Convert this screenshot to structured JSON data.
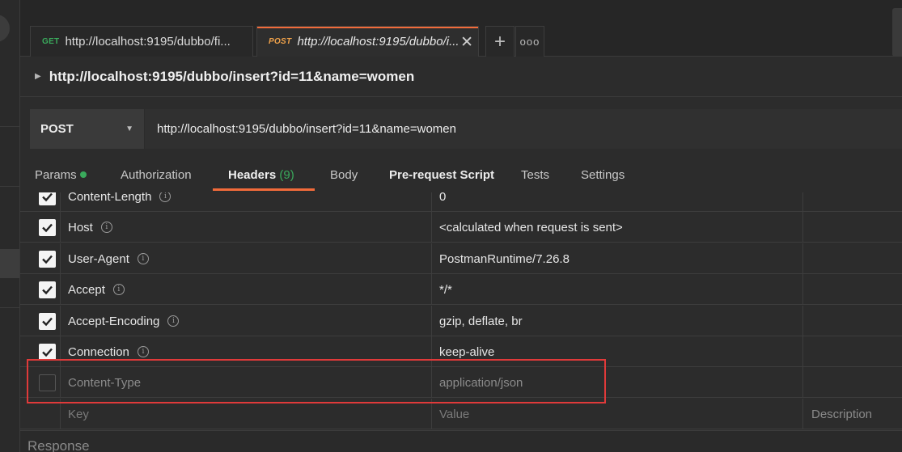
{
  "tabs": [
    {
      "method": "GET",
      "url": "http://localhost:9195/dubbo/fi..."
    },
    {
      "method": "POST",
      "url": "http://localhost:9195/dubbo/i..."
    }
  ],
  "tab_actions": {
    "add": "+",
    "more": "ooo",
    "close": "✕"
  },
  "request": {
    "title": "http://localhost:9195/dubbo/insert?id=11&name=women",
    "method": "POST",
    "url": "http://localhost:9195/dubbo/insert?id=11&name=women"
  },
  "request_tabs": {
    "params": "Params",
    "authorization": "Authorization",
    "headers": "Headers",
    "headers_count": "(9)",
    "body": "Body",
    "prerequest": "Pre-request Script",
    "tests": "Tests",
    "settings": "Settings"
  },
  "headers": [
    {
      "key": "Content-Length",
      "value": "0",
      "checked": true
    },
    {
      "key": "Host",
      "value": "<calculated when request is sent>",
      "checked": true
    },
    {
      "key": "User-Agent",
      "value": "PostmanRuntime/7.26.8",
      "checked": true
    },
    {
      "key": "Accept",
      "value": "*/*",
      "checked": true
    },
    {
      "key": "Accept-Encoding",
      "value": "gzip, deflate, br",
      "checked": true
    },
    {
      "key": "Connection",
      "value": "keep-alive",
      "checked": true
    },
    {
      "key": "Content-Type",
      "value": "application/json",
      "checked": false
    }
  ],
  "placeholder_row": {
    "key": "Key",
    "value": "Value",
    "description": "Description"
  },
  "response_label": "Response",
  "colors": {
    "accent": "#f26b3a",
    "get": "#3aaa5c",
    "post": "#f0a24a",
    "highlight": "#e03a3a"
  }
}
